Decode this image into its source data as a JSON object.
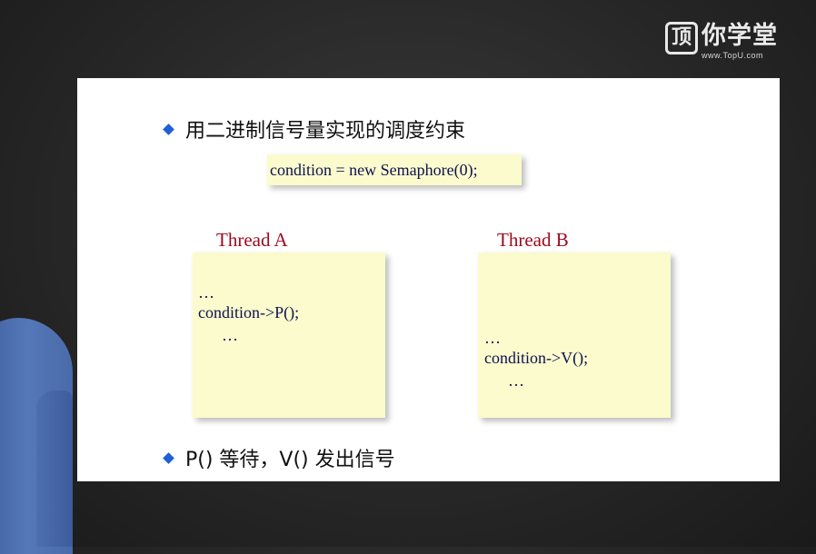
{
  "logo": {
    "mark": "顶",
    "brand_text": "你学堂",
    "url": "www.TopU.com"
  },
  "slide": {
    "bullet1": "用二进制信号量实现的调度约束",
    "init_code": "condition = new Semaphore(0);",
    "thread_a": {
      "title": "Thread A",
      "lines": [
        "…",
        "condition->P();",
        "…"
      ]
    },
    "thread_b": {
      "title": "Thread B",
      "lines": [
        "…",
        "condition->V();",
        "…"
      ]
    },
    "bullet2": "P() 等待，V() 发出信号"
  },
  "colors": {
    "bullet_accent": "#1f5fd6",
    "thread_title": "#a00a1e",
    "code_text": "#0d1250",
    "note_background": "#fbfbcd"
  },
  "icons": [
    "diamond-bullet-icon"
  ]
}
